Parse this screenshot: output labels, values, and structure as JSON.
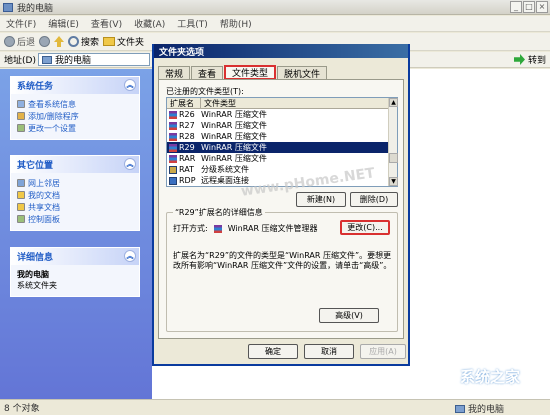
{
  "window": {
    "title": "我的电脑"
  },
  "menu": [
    "文件(F)",
    "编辑(E)",
    "查看(V)",
    "收藏(A)",
    "工具(T)",
    "帮助(H)"
  ],
  "toolbar": {
    "back": "后退",
    "search": "搜索",
    "folders": "文件夹"
  },
  "address": {
    "label": "地址(D)",
    "value": "我的电脑",
    "go": "转到"
  },
  "panels": {
    "system": {
      "title": "系统任务",
      "items": [
        "查看系统信息",
        "添加/删除程序",
        "更改一个设置"
      ]
    },
    "places": {
      "title": "其它位置",
      "items": [
        "网上邻居",
        "我的文档",
        "共享文档",
        "控制面板"
      ]
    },
    "details": {
      "title": "详细信息",
      "name": "我的电脑",
      "type": "系统文件夹"
    }
  },
  "dialog": {
    "title": "文件夹选项",
    "tabs": [
      "常规",
      "查看",
      "文件类型",
      "脱机文件"
    ],
    "registered_label": "已注册的文件类型(T):",
    "columns": [
      "扩展名",
      "文件类型"
    ],
    "rows": [
      {
        "ext": "R26",
        "type": "WinRAR 压缩文件"
      },
      {
        "ext": "R27",
        "type": "WinRAR 压缩文件"
      },
      {
        "ext": "R28",
        "type": "WinRAR 压缩文件"
      },
      {
        "ext": "R29",
        "type": "WinRAR 压缩文件",
        "selected": true
      },
      {
        "ext": "RAR",
        "type": "WinRAR 压缩文件"
      },
      {
        "ext": "RAT",
        "type": "分级系统文件"
      },
      {
        "ext": "RDP",
        "type": "远程桌面连接"
      }
    ],
    "new_btn": "新建(N)",
    "delete_btn": "删除(D)",
    "details_title": "“R29”扩展名的详细信息",
    "opens_with_label": "打开方式:",
    "opens_with_value": "WinRAR 压缩文件管理器",
    "change_btn": "更改(C)...",
    "description": "扩展名为“R29”的文件的类型是“WinRAR 压缩文件”。要想更改所有影响“WinRAR 压缩文件”文件的设置，请单击“高级”。",
    "advanced_btn": "高级(V)",
    "ok_btn": "确定",
    "cancel_btn": "取消",
    "apply_btn": "应用(A)"
  },
  "status": {
    "left": "8 个对象",
    "right": "我的电脑"
  },
  "watermark": "www.pHome.NET",
  "logo": {
    "text": "系统之家",
    "url": "XITONGZHIJIA.NET"
  }
}
